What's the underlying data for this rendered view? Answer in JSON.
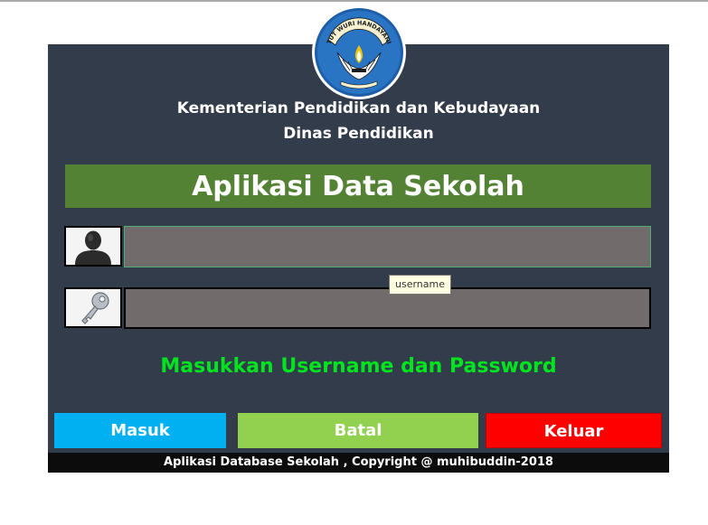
{
  "header": {
    "line1": "Kementerian Pendidikan dan Kebudayaan",
    "line2": "Dinas Pendidikan",
    "logo_text": "TUT WURI HANDAYANI"
  },
  "title": "Aplikasi Data Sekolah",
  "form": {
    "username_value": "",
    "password_value": "",
    "username_tooltip": "username",
    "user_icon": "user-silhouette-icon",
    "key_icon": "key-icon"
  },
  "prompt": "Masukkan Username dan Password",
  "buttons": {
    "masuk": "Masuk",
    "batal": "Batal",
    "keluar": "Keluar"
  },
  "footer": "Aplikasi Database Sekolah , Copyright @ muhibuddin-2018",
  "colors": {
    "panel": "#323c4a",
    "title_bar": "#538234",
    "field": "#716b6b",
    "prompt": "#00e41f",
    "masuk": "#00b0f0",
    "batal": "#92d050",
    "keluar": "#ff0000"
  }
}
